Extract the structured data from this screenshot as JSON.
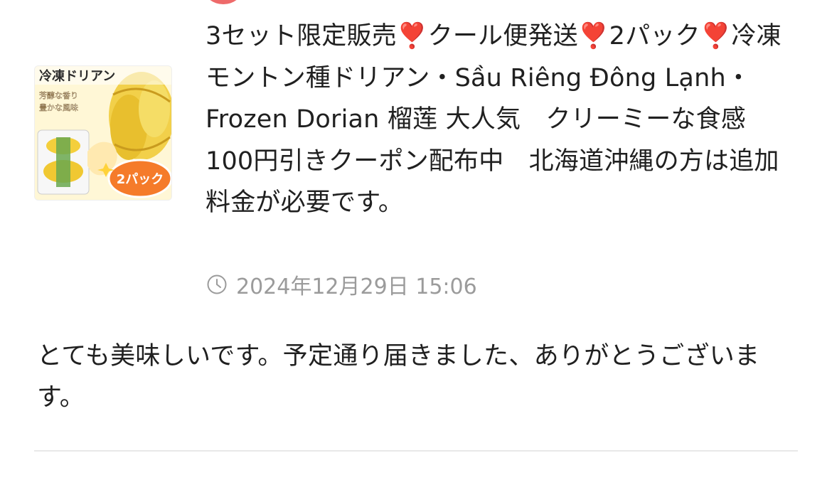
{
  "product": {
    "title": "3セット限定販売❣️クール便発送❣️2パック❣️冷凍モントン種ドリアン・Sầu Riêng Đông Lạnh・Frozen Dorian 榴莲 大人気　クリーミーな食感　100円引きクーポン配布中　北海道沖縄の方は追加料金が必要です。",
    "image_alt": "冷凍ドリアン",
    "image_text": {
      "headline": "冷凍ドリアン",
      "tagline_1": "芳醇な香り",
      "tagline_2": "豊かな風味",
      "badge": "2パック"
    }
  },
  "review": {
    "timestamp": "2024年12月29日 15:06",
    "comment": "とても美味しいです。予定通り届きました、ありがとうございます。"
  },
  "icons": {
    "timestamp": "clock-icon"
  },
  "colors": {
    "avatar": "#ee6a6a",
    "meta_text": "#9b9b9b",
    "divider": "#e8e8e8"
  }
}
